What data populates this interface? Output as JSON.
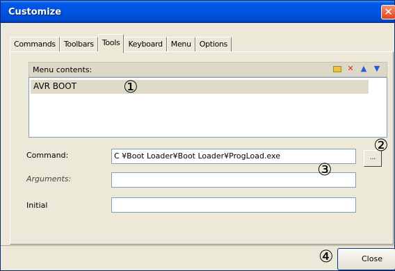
{
  "window": {
    "title": "Customize",
    "close_glyph": "✕"
  },
  "tabs": [
    {
      "label": "Commands",
      "active": false
    },
    {
      "label": "Toolbars",
      "active": false
    },
    {
      "label": "Tools",
      "active": true
    },
    {
      "label": "Keyboard",
      "active": false
    },
    {
      "label": "Menu",
      "active": false
    },
    {
      "label": "Options",
      "active": false
    }
  ],
  "menu_contents": {
    "label": "Menu contents:",
    "icons": [
      "folder-icon",
      "delete-icon",
      "move-up-icon",
      "move-down-icon"
    ],
    "items": [
      "AVR BOOT"
    ]
  },
  "fields": {
    "command": {
      "label": "Command:",
      "value": "C     ¥Boot Loader¥Boot Loader¥ProgLoad.exe"
    },
    "arguments": {
      "label": "Arguments:",
      "value": ""
    },
    "initial": {
      "label": "Initial",
      "value": ""
    }
  },
  "browse_button": {
    "label": "..."
  },
  "close_button": {
    "label": "Close"
  },
  "callouts": [
    "①",
    "②",
    "③",
    "④"
  ]
}
